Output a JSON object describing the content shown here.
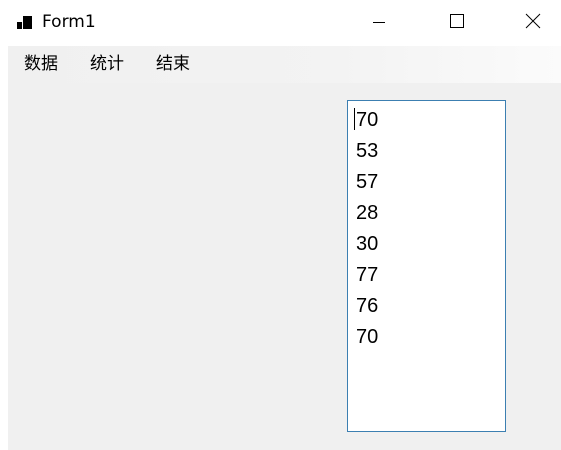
{
  "window": {
    "title": "Form1"
  },
  "menu": {
    "items": [
      {
        "label": "数据"
      },
      {
        "label": "统计"
      },
      {
        "label": "结束"
      }
    ]
  },
  "listbox": {
    "items": [
      "70",
      "53",
      "57",
      "28",
      "30",
      "77",
      "76",
      "70"
    ]
  },
  "icons": {
    "app": "form-app-icon",
    "minimize": "minimize-icon",
    "maximize": "maximize-icon",
    "close": "close-icon"
  },
  "colors": {
    "listbox_border": "#3c7fb1",
    "client_background": "#f0f0f0"
  }
}
